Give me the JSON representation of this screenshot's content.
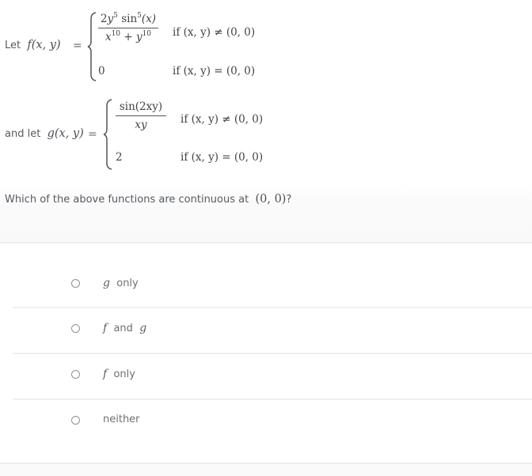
{
  "definitions": {
    "f": {
      "lead": "Let",
      "name": "f",
      "args": "(x, y)",
      "equals": "=",
      "case1": {
        "numerator": "2y⁵ sin⁵(x)",
        "num_parts": {
          "coef": "2",
          "var": "y",
          "exp1": "5",
          "fn": "sin",
          "exp2": "5",
          "arg": "(x)"
        },
        "den_parts": {
          "var1": "x",
          "exp1": "10",
          "plus": "+",
          "var2": "y",
          "exp2": "10"
        },
        "condition": "if (x, y) ≠ (0, 0)"
      },
      "case2": {
        "value": "0",
        "condition": "if (x, y) = (0, 0)"
      }
    },
    "g": {
      "lead": "and let",
      "name": "g",
      "args": "(x, y)",
      "equals": "=",
      "case1": {
        "numerator": "sin(2xy)",
        "denominator": "xy",
        "condition": "if (x, y) ≠ (0, 0)"
      },
      "case2": {
        "value": "2",
        "condition": "if (x, y) = (0, 0)"
      }
    }
  },
  "question": {
    "text": "Which of the above functions are continuous at",
    "point": "(0, 0)",
    "suffix": "?"
  },
  "options": [
    {
      "id": "g-only",
      "math": "g",
      "text": "only",
      "selected": false
    },
    {
      "id": "f-and-g",
      "math1": "f",
      "text": "and",
      "math2": "g",
      "selected": false
    },
    {
      "id": "f-only",
      "math": "f",
      "text": "only",
      "selected": false
    },
    {
      "id": "neither",
      "text": "neither",
      "selected": false
    }
  ]
}
